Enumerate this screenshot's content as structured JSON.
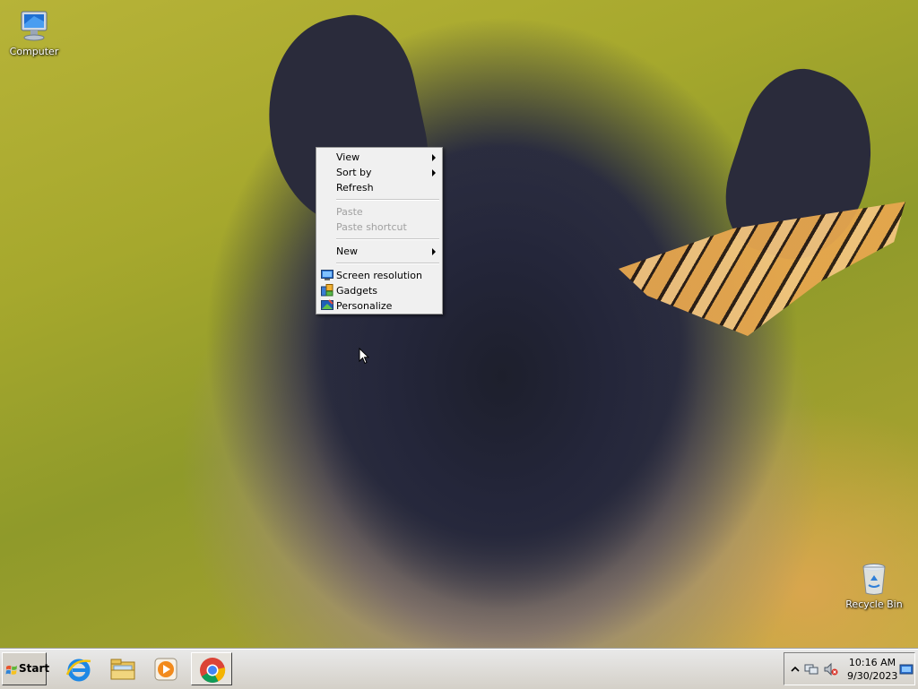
{
  "desktop": {
    "icons": [
      {
        "label": "Computer",
        "icon": "computer-icon"
      },
      {
        "label": "Recycle Bin",
        "icon": "recycle-bin-icon"
      }
    ]
  },
  "context_menu": {
    "items": [
      {
        "label": "View",
        "submenu": true,
        "enabled": true
      },
      {
        "label": "Sort by",
        "submenu": true,
        "enabled": true
      },
      {
        "label": "Refresh",
        "enabled": true
      },
      {
        "label": "Paste",
        "enabled": false
      },
      {
        "label": "Paste shortcut",
        "enabled": false
      },
      {
        "label": "New",
        "submenu": true,
        "enabled": true
      },
      {
        "label": "Screen resolution",
        "icon": "screen-resolution-icon",
        "enabled": true
      },
      {
        "label": "Gadgets",
        "icon": "gadgets-icon",
        "enabled": true
      },
      {
        "label": "Personalize",
        "icon": "personalize-icon",
        "enabled": true
      }
    ]
  },
  "taskbar": {
    "start_label": "Start",
    "pinned": [
      {
        "icon": "internet-explorer-icon"
      },
      {
        "icon": "file-explorer-icon"
      },
      {
        "icon": "media-player-icon"
      },
      {
        "icon": "chrome-icon",
        "active": true
      }
    ],
    "tray": {
      "icons": [
        "show-hidden-icons-chevron",
        "network-icon",
        "volume-muted-icon",
        "show-desktop-icon"
      ],
      "time": "10:16 AM",
      "date": "9/30/2023"
    }
  },
  "colors": {
    "menu_background": "#f0f0f0",
    "taskbar_background": "#d4d0c8",
    "disabled_text": "#a0a0a0"
  }
}
